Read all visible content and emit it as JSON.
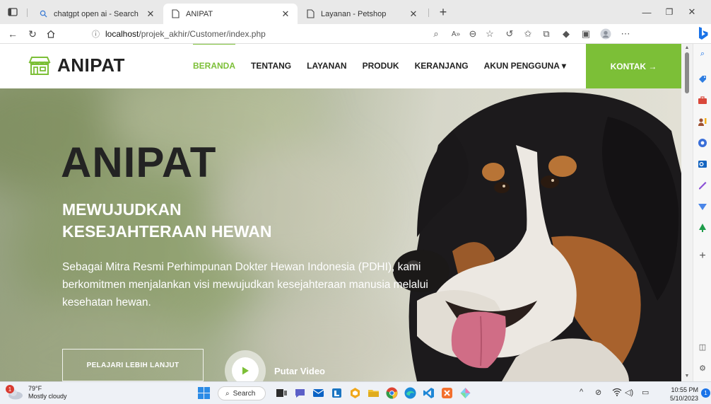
{
  "browser": {
    "tabs": [
      {
        "title": "chatgpt open ai - Search",
        "active": false
      },
      {
        "title": "ANIPAT",
        "active": true
      },
      {
        "title": "Layanan - Petshop",
        "active": false
      }
    ],
    "new_tab_symbol": "+",
    "address": {
      "host": "localhost",
      "path": "/projek_akhir/Customer/index.php"
    },
    "colors": {
      "accent": "#7cbf37",
      "edge_blue": "#1a73e8"
    }
  },
  "site": {
    "logo_text": "ANIPAT",
    "menu": [
      {
        "label": "BERANDA",
        "active": true
      },
      {
        "label": "TENTANG",
        "active": false
      },
      {
        "label": "LAYANAN",
        "active": false
      },
      {
        "label": "PRODUK",
        "active": false
      },
      {
        "label": "KERANJANG",
        "active": false
      },
      {
        "label": "AKUN PENGGUNA ▾",
        "active": false
      }
    ],
    "cta": "KONTAK →"
  },
  "hero": {
    "title": "ANIPAT",
    "subtitle_line1": "MEWUJUDKAN",
    "subtitle_line2": "KESEJAHTERAAN HEWAN",
    "description": "Sebagai Mitra Resmi Perhimpunan Dokter Hewan Indonesia (PDHI), kami berkomitmen menjalankan visi mewujudkan kesejahteraan manusia melalui kesehatan hewan.",
    "learn_more": "PELAJARI LEBIH LANJUT",
    "play_label": "Putar Video"
  },
  "taskbar": {
    "weather_temp": "79°F",
    "weather_desc": "Mostly cloudy",
    "weather_badge": "1",
    "search_label": "Search",
    "time": "10:55 PM",
    "date": "5/10/2023",
    "notification_count": "1"
  }
}
